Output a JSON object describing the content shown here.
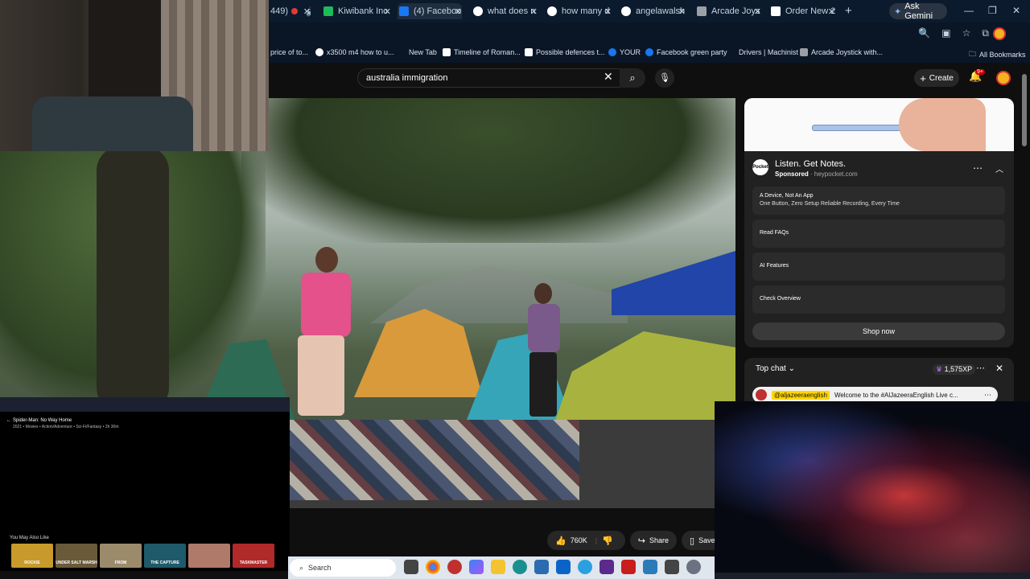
{
  "browser": {
    "tabs": [
      {
        "label": "449)",
        "color": "#e53935"
      },
      {
        "label": "Kiwibank Inc",
        "color": "#1fba5a"
      },
      {
        "label": "(4) Facebook",
        "color": "#1877f2"
      },
      {
        "label": "what does n",
        "color": "#ffffff"
      },
      {
        "label": "how many d",
        "color": "#ffffff"
      },
      {
        "label": "angelawalsh",
        "color": "#ffffff"
      },
      {
        "label": "Arcade Joys",
        "color": "#9aa0a6"
      },
      {
        "label": "Order New 2",
        "color": "#ffffff"
      }
    ],
    "gemini_label": "Ask Gemini",
    "bookmarks": [
      {
        "label": "price of to...",
        "color": "#0a1626"
      },
      {
        "label": "x3500 m4 how to u...",
        "color": "#ffffff"
      },
      {
        "label": "New Tab",
        "color": "#0a1626"
      },
      {
        "label": "Timeline of Roman...",
        "color": "#ffffff"
      },
      {
        "label": "Possible defences t...",
        "color": "#0a1626"
      },
      {
        "label": "YOUR",
        "color": "#1877f2"
      },
      {
        "label": "Facebook green party",
        "color": "#1877f2"
      },
      {
        "label": "Drivers | Machinist",
        "color": "#0a1626"
      },
      {
        "label": "Arcade Joystick with...",
        "color": "#9aa0a6"
      }
    ],
    "all_bookmarks": "All Bookmarks"
  },
  "youtube": {
    "search_value": "australia immigration",
    "create_label": "Create",
    "notif_badge": "9+",
    "likes": "760K",
    "share_label": "Share",
    "save_label": "Save"
  },
  "ad": {
    "title": "Listen. Get Notes.",
    "sponsored": "Sponsored",
    "domain": "heypocket.com",
    "logo_text": "Pocket",
    "rows": [
      {
        "title": "A Device, Not An App",
        "sub": "One Button, Zero Setup Reliable Recording, Every Time"
      },
      {
        "title": "Read FAQs",
        "sub": ""
      },
      {
        "title": "AI Features",
        "sub": ""
      },
      {
        "title": "Check Overview",
        "sub": ""
      }
    ],
    "shop_label": "Shop now"
  },
  "chat": {
    "title": "Top chat",
    "xp": "1,575XP",
    "message_author": "@aljazeeraenglish",
    "message_text": "Welcome to the #AlJazeeraEnglish Live c..."
  },
  "overlay_streaming": {
    "title": "Spider-Man: No Way Home",
    "meta": "2021 • Movies • Action/Adventure • Sci-Fi/Fantasy • 2h 30m",
    "you_may_also_like": "You May Also Like",
    "thumbs": [
      {
        "label": "ROCKIE",
        "color": "#c79a2b"
      },
      {
        "label": "UNDER SALT MARSH",
        "color": "#6b5a3a"
      },
      {
        "label": "FROM",
        "color": "#9c8b6b"
      },
      {
        "label": "THE CAPTURE",
        "color": "#1e5a6a"
      },
      {
        "label": "",
        "color": "#b07a6a"
      },
      {
        "label": "TASKMASTER",
        "color": "#b02a2a"
      }
    ]
  },
  "taskbar": {
    "search_label": "Search"
  }
}
